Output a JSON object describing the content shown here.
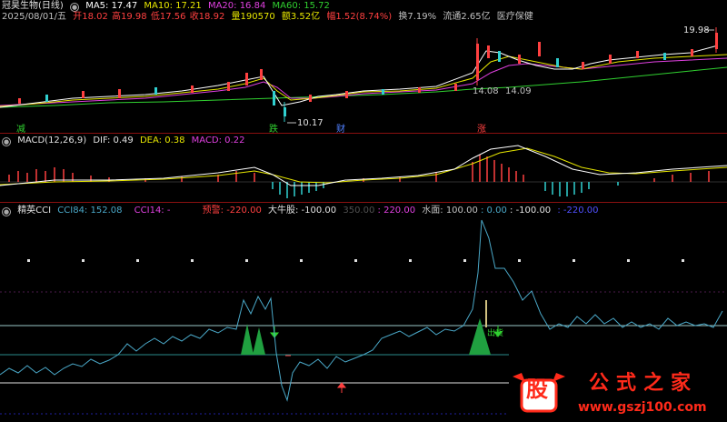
{
  "main": {
    "stock_name": "冠昊生物(日线)",
    "ma": [
      {
        "label": "MA5: 17.47",
        "color": "#ffffff"
      },
      {
        "label": "MA10: 17.21",
        "color": "#e6e600"
      },
      {
        "label": "MA20: 16.84",
        "color": "#e040e0"
      },
      {
        "label": "MA60: 15.72",
        "color": "#30d030"
      }
    ],
    "info": [
      {
        "text": "2025/08/01/五",
        "color": "#c0c0c0"
      },
      {
        "text": "开18.02",
        "color": "#ff4040"
      },
      {
        "text": "高19.98",
        "color": "#ff4040"
      },
      {
        "text": "低17.56",
        "color": "#ff4040"
      },
      {
        "text": "收18.92",
        "color": "#ff4040"
      },
      {
        "text": "量190570",
        "color": "#e6e600"
      },
      {
        "text": "额3.52亿",
        "color": "#e6e600"
      },
      {
        "text": "幅1.52(8.74%)",
        "color": "#ff4040"
      },
      {
        "text": "换7.19%",
        "color": "#c0c0c0"
      },
      {
        "text": "流通2.65亿",
        "color": "#c0c0c0"
      },
      {
        "text": "医疗保健",
        "color": "#c0c0c0"
      }
    ],
    "high_label": "19.98",
    "low_label": "10.17",
    "range_label_1": "14.08",
    "range_label_2": "14.09",
    "markers": [
      {
        "text": "减",
        "color": "#30d030"
      },
      {
        "text": "跌",
        "color": "#30d030"
      },
      {
        "text": "财",
        "color": "#5080ff"
      },
      {
        "text": "涨",
        "color": "#ff4040"
      }
    ]
  },
  "macd": {
    "title": "MACD(12,26,9)",
    "dif": "DIF: 0.49",
    "dea": "DEA: 0.38",
    "macd": "MACD: 0.22"
  },
  "cci": {
    "title": "精英CCI",
    "items": [
      {
        "text": "CCI84: 152.08",
        "color": "#4aa8c8"
      },
      {
        "text": "CCI14: -",
        "color": "#e040e0"
      },
      {
        "text": "预警: -220.00",
        "color": "#ff4040"
      },
      {
        "text": "大牛股: -100.00",
        "color": "#e0e0e0"
      },
      {
        "text": "350.00",
        "color": "#505050"
      },
      {
        "text": ": 220.00",
        "color": "#e040e0"
      },
      {
        "text": "水面: 100.00",
        "color": "#c0c0c0"
      },
      {
        "text": ": 0.00",
        "color": "#4aa8c8"
      },
      {
        "text": ": -100.00",
        "color": "#e0e0e0"
      },
      {
        "text": ": -220.00",
        "color": "#5050ff"
      }
    ],
    "sell_label": "出货"
  },
  "watermark": {
    "logo_char": "股",
    "name": "公式之家",
    "url": "www.gszj100.com"
  }
}
